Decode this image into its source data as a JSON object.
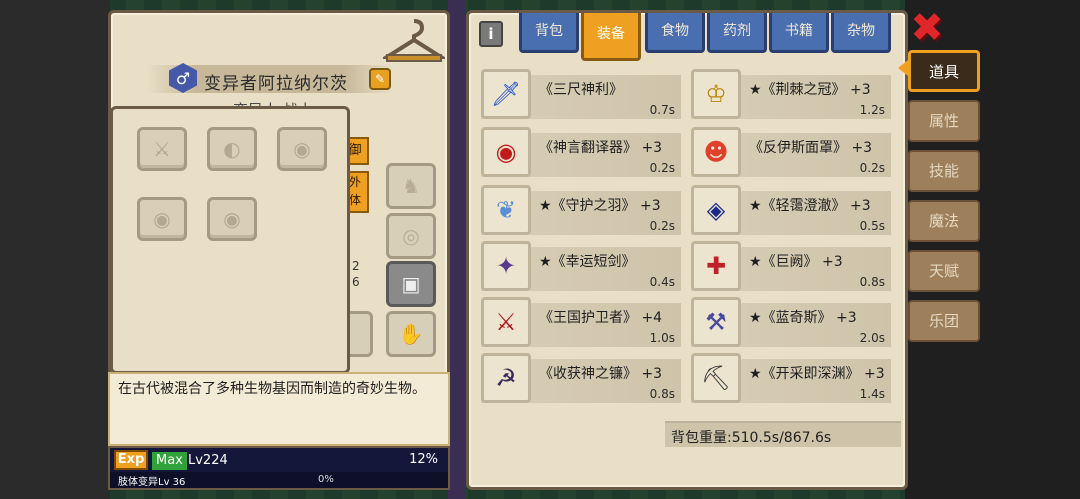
{
  "character": {
    "gender_symbol": "♂",
    "name": "变异者阿拉纳尔茨",
    "subtitle": "变异人 战士",
    "tab_defense": "御",
    "tab_extra": "外\n体",
    "stat_a": "2",
    "stat_b": "6",
    "description": "在古代被混合了多种生物基因而制造的奇妙生物。"
  },
  "exp": {
    "exp_label": "Exp",
    "max_label": "Max",
    "level": "Lv224",
    "percent": "12%",
    "sub_label": "肢体变异Lv 36",
    "sub_percent": "0%"
  },
  "inventory": {
    "info_icon": "i",
    "tabs": [
      {
        "label": "背包"
      },
      {
        "label": "装备",
        "active": true
      },
      {
        "label": "食物"
      },
      {
        "label": "药剂"
      },
      {
        "label": "书籍"
      },
      {
        "label": "杂物"
      }
    ],
    "items": [
      {
        "name": "《三尺神利》",
        "weight": "0.7s",
        "icon": "sword-icon"
      },
      {
        "name": "★《荆棘之冠》 +3",
        "weight": "1.2s",
        "icon": "thorn-crown-icon"
      },
      {
        "name": "《神言翻译器》 +3",
        "weight": "0.2s",
        "icon": "translator-icon"
      },
      {
        "name": "《反伊斯面罩》 +3",
        "weight": "0.2s",
        "icon": "mask-icon"
      },
      {
        "name": "★《守护之羽》 +3",
        "weight": "0.2s",
        "icon": "feather-icon"
      },
      {
        "name": "★《轻霭澄澈》 +3",
        "weight": "0.5s",
        "icon": "cloak-icon"
      },
      {
        "name": "★《幸运短剑》",
        "weight": "0.4s",
        "icon": "dagger-icon"
      },
      {
        "name": "★《巨阙》 +3",
        "weight": "0.8s",
        "icon": "greatsword-icon"
      },
      {
        "name": "《王国护卫者》 +4",
        "weight": "1.0s",
        "icon": "red-sword-icon"
      },
      {
        "name": "★《蓝奇斯》 +3",
        "weight": "2.0s",
        "icon": "axe-icon"
      },
      {
        "name": "《收获神之镰》 +3",
        "weight": "0.8s",
        "icon": "scythe-icon"
      },
      {
        "name": "★《开采即深渊》 +3",
        "weight": "1.4s",
        "icon": "pickaxe-icon"
      }
    ],
    "weight_text": "背包重量:510.5s/867.6s"
  },
  "side_tabs": [
    {
      "label": "道具",
      "active": true
    },
    {
      "label": "属性"
    },
    {
      "label": "技能"
    },
    {
      "label": "魔法"
    },
    {
      "label": "天赋"
    },
    {
      "label": "乐团"
    }
  ],
  "close_icon": "✖"
}
